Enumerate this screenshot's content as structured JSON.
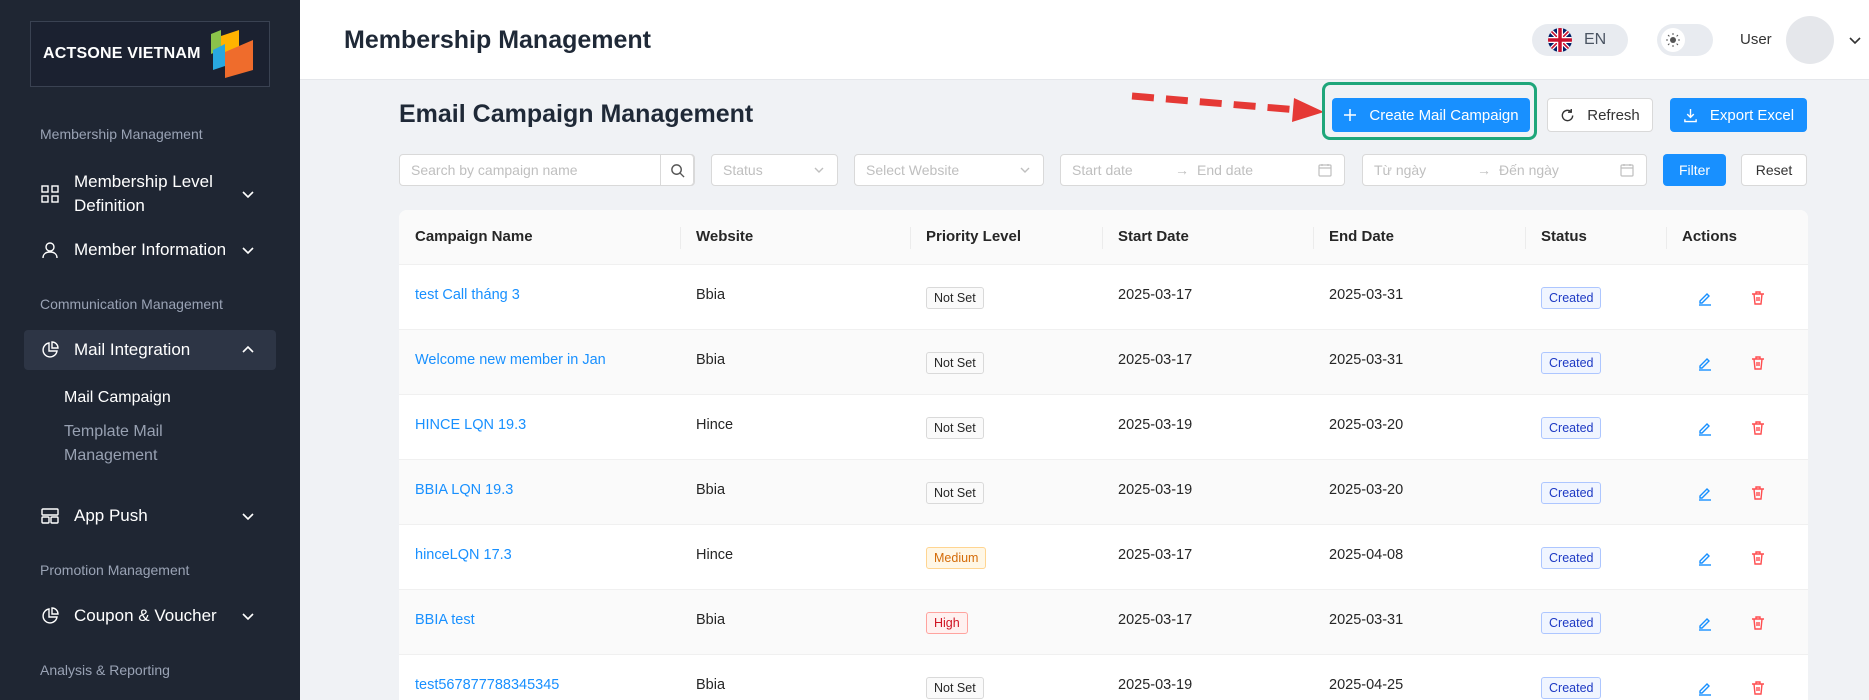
{
  "sidebar": {
    "logo_text": "ACTSONE VIETNAM",
    "sections": {
      "membership": "Membership Management",
      "communication": "Communication Management",
      "promotion": "Promotion Management",
      "analysis": "Analysis & Reporting"
    },
    "items": {
      "membership_level": "Membership Level Definition",
      "member_info": "Member Information",
      "mail_integration": "Mail Integration",
      "app_push": "App Push",
      "coupon_voucher": "Coupon & Voucher"
    },
    "sub_items": {
      "mail_campaign": "Mail Campaign",
      "template_mail": "Template Mail Management"
    }
  },
  "header": {
    "title": "Membership Management",
    "language": "EN",
    "user_label": "User"
  },
  "main": {
    "title": "Email Campaign Management",
    "create_button": "Create Mail Campaign",
    "refresh_button": "Refresh",
    "export_button": "Export Excel",
    "filter_button": "Filter",
    "reset_button": "Reset",
    "filters": {
      "search_placeholder": "Search by campaign name",
      "status_placeholder": "Status",
      "website_placeholder": "Select Website",
      "start_date": "Start date",
      "end_date": "End date",
      "from_date": "Từ ngày",
      "to_date": "Đến ngày"
    }
  },
  "table": {
    "columns": [
      "Campaign Name",
      "Website",
      "Priority Level",
      "Start Date",
      "End Date",
      "Status",
      "Actions"
    ],
    "rows": [
      {
        "name": "test Call tháng 3",
        "website": "Bbia",
        "priority": "Not Set",
        "start": "2025-03-17",
        "end": "2025-03-31",
        "status": "Created"
      },
      {
        "name": "Welcome new member in Jan",
        "website": "Bbia",
        "priority": "Not Set",
        "start": "2025-03-17",
        "end": "2025-03-31",
        "status": "Created"
      },
      {
        "name": "HINCE LQN 19.3",
        "website": "Hince",
        "priority": "Not Set",
        "start": "2025-03-19",
        "end": "2025-03-20",
        "status": "Created"
      },
      {
        "name": "BBIA LQN 19.3",
        "website": "Bbia",
        "priority": "Not Set",
        "start": "2025-03-19",
        "end": "2025-03-20",
        "status": "Created"
      },
      {
        "name": "hinceLQN 17.3",
        "website": "Hince",
        "priority": "Medium",
        "start": "2025-03-17",
        "end": "2025-04-08",
        "status": "Created"
      },
      {
        "name": "BBIA test",
        "website": "Bbia",
        "priority": "High",
        "start": "2025-03-17",
        "end": "2025-03-31",
        "status": "Created"
      },
      {
        "name": "test567877788345345",
        "website": "Bbia",
        "priority": "Not Set",
        "start": "2025-03-19",
        "end": "2025-04-25",
        "status": "Created"
      }
    ]
  },
  "colors": {
    "primary": "#1890ff",
    "sidebar_bg": "#1f2633",
    "highlight": "#1fa67a",
    "arrow": "#e53935"
  }
}
